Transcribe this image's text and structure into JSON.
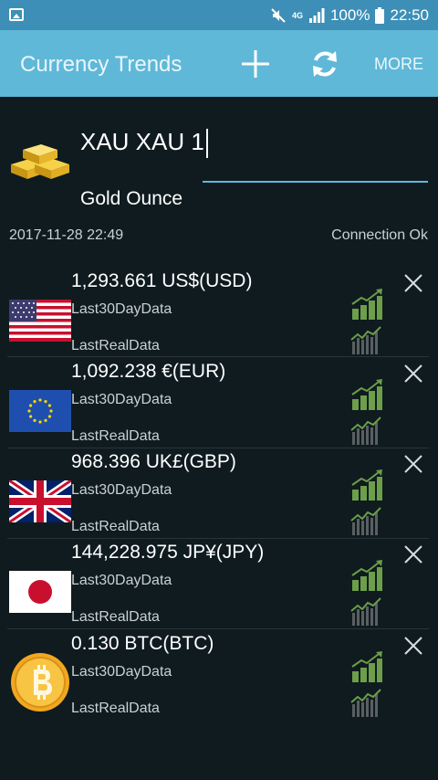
{
  "status_bar": {
    "network": "4G",
    "battery_percent": "100%",
    "time": "22:50"
  },
  "app_bar": {
    "title": "Currency Trends",
    "add_icon": "plus-icon",
    "refresh_icon": "refresh-icon",
    "more_label": "MORE"
  },
  "base": {
    "icon": "gold-bars-icon",
    "amount_text": "XAU XAU 1",
    "name": "Gold Ounce"
  },
  "info": {
    "timestamp": "2017-11-28 22:49",
    "connection": "Connection Ok"
  },
  "rates": [
    {
      "flag": "us-flag-icon",
      "value": "1,293.661 US$(USD)",
      "last30": "Last30DayData",
      "lastreal": "LastRealData"
    },
    {
      "flag": "eu-flag-icon",
      "value": "1,092.238 €(EUR)",
      "last30": "Last30DayData",
      "lastreal": "LastRealData"
    },
    {
      "flag": "uk-flag-icon",
      "value": "968.396 UK£(GBP)",
      "last30": "Last30DayData",
      "lastreal": "LastRealData"
    },
    {
      "flag": "jp-flag-icon",
      "value": "144,228.975 JP¥(JPY)",
      "last30": "Last30DayData",
      "lastreal": "LastRealData"
    },
    {
      "flag": "bitcoin-icon",
      "value": "0.130 BTC(BTC)",
      "last30": "Last30DayData",
      "lastreal": "LastRealData"
    }
  ],
  "colors": {
    "status_bar": "#3d8fb7",
    "app_bar": "#5fb8d8",
    "background": "#0f1b1f",
    "trend_green": "#6d9e4a"
  }
}
